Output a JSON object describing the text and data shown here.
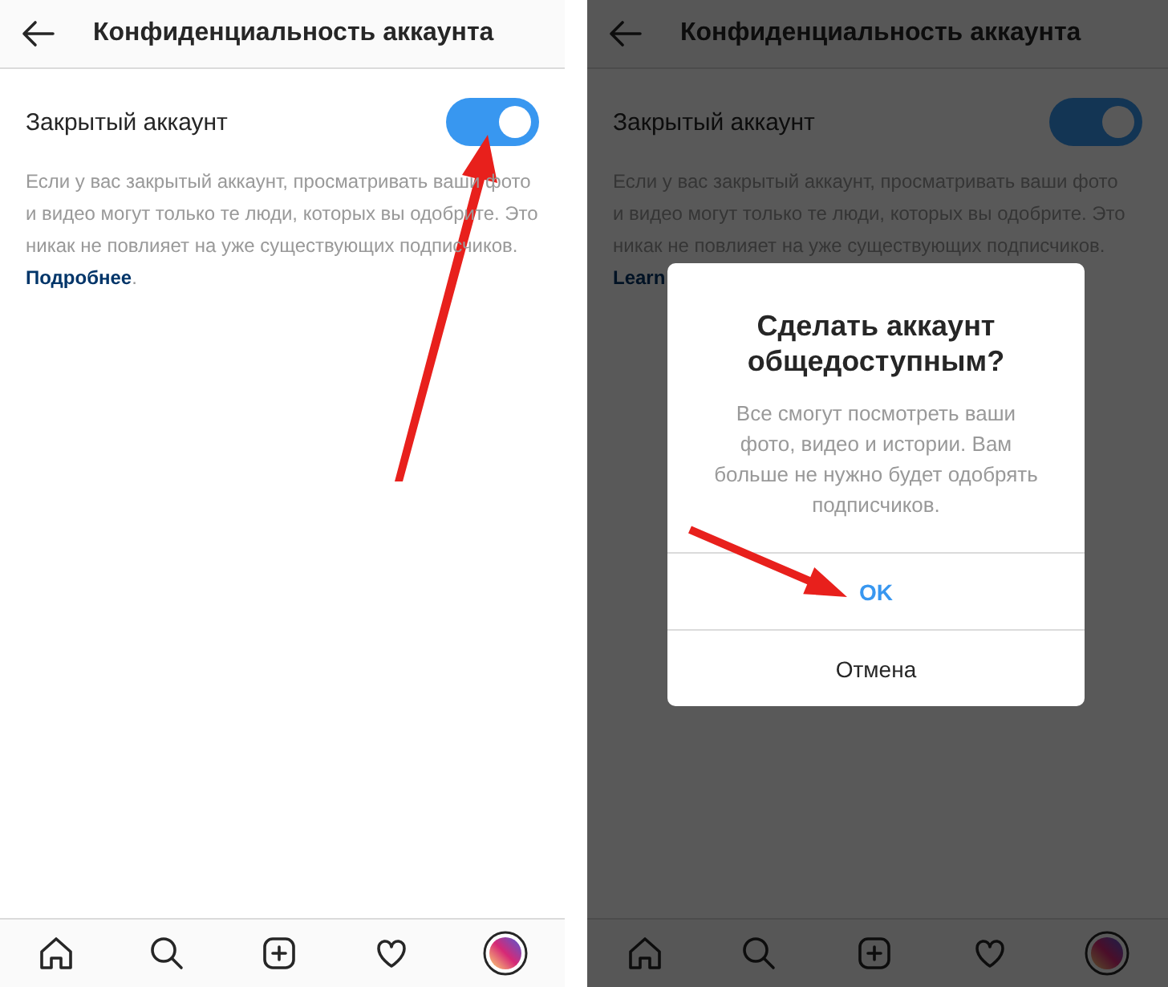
{
  "screens": [
    {
      "dimmed": false,
      "header": {
        "title": "Конфиденциальность аккаунта"
      },
      "setting": {
        "label": "Закрытый аккаунт",
        "on": true
      },
      "description_lines": [
        "Если у вас закрытый аккаунт, просматривать ваши фото",
        "и видео могут только те люди, которых вы одобрите. Это",
        "никак не повлияет на уже существующих подписчиков."
      ],
      "link": "Подробнее",
      "link_end": "."
    },
    {
      "dimmed": true,
      "header": {
        "title": "Конфиденциальность аккаунта"
      },
      "setting": {
        "label": "Закрытый аккаунт",
        "on": true
      },
      "description_lines": [
        "Если у вас закрытый аккаунт, просматривать ваши фото",
        "и видео могут только те люди, которых вы одобрите. Это",
        "никак не повлияет на уже существующих подписчиков."
      ],
      "link": "Learn",
      "dialog": {
        "title": "Сделать аккаунт общедоступным?",
        "message": "Все смогут посмотреть ваши фото, видео и истории. Вам больше не нужно будет одобрять подписчиков.",
        "buttons": [
          {
            "label": "OK",
            "kind": "primary"
          },
          {
            "label": "Отмена",
            "kind": "plain"
          }
        ]
      }
    }
  ]
}
